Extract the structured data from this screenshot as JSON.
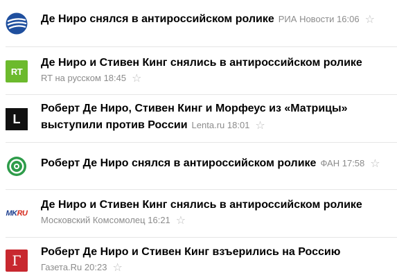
{
  "news": [
    {
      "headline": "Де Ниро снялся в антироссийском ролике",
      "source": "РИА Новости",
      "time": "16:06",
      "logo": "РИА",
      "logo_icon": "ria-novosti-logo-icon"
    },
    {
      "headline": "Де Ниро и Стивен Кинг снялись в антироссийском ролике",
      "source": "RT на русском",
      "time": "18:45",
      "logo": "RT",
      "logo_color": "#6cba2d"
    },
    {
      "headline_line1": "Роберт Де Ниро, Стивен Кинг и Морфеус из «Матрицы»",
      "headline_line2": "выступили против России",
      "source": "Lenta.ru",
      "time": "18:01",
      "logo": "L",
      "logo_color": "#111111"
    },
    {
      "headline": "Роберт Де Ниро снялся в антироссийском ролике",
      "source": "ФАН",
      "time": "17:58",
      "logo_icon": "fan-logo-icon",
      "logo_color": "#2e9c4a"
    },
    {
      "headline": "Де Ниро и Стивен Кинг снялись в антироссийском ролике",
      "source": "Московский Комсомолец",
      "time": "16:21",
      "logo_mk": "MK",
      "logo_ru": "RU"
    },
    {
      "headline": "Роберт Де Ниро и Стивен Кинг взъерились на Россию",
      "source": "Газета.Ru",
      "time": "20:23",
      "logo": "Г",
      "logo_color": "#c8282f"
    }
  ],
  "star_glyph": "☆",
  "colors": {
    "meta_text": "#8b8b8b",
    "star": "#b9b9b9",
    "divider": "#e6e6e6"
  }
}
